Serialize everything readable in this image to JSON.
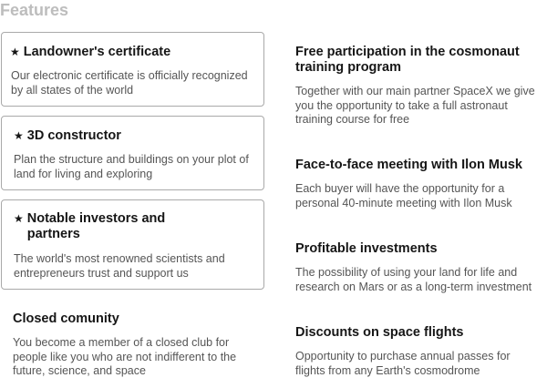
{
  "section": {
    "title": "Features"
  },
  "left": [
    {
      "title": "Landowner's certificate",
      "description": "Our electronic certificate is officially recognized by all states of the world",
      "icon": "star-icon"
    },
    {
      "title": "3D constructor",
      "description": "Plan the structure and buildings on your plot of land for living and exploring",
      "icon": "star-icon"
    },
    {
      "title": "Notable investors and partners",
      "description": "The world's most renowned scientists and entrepreneurs trust and support us",
      "icon": "star-icon"
    },
    {
      "title": "Closed comunity",
      "description": "You become a member of a closed club for people like you who are not indifferent to the future, science, and space"
    }
  ],
  "right": [
    {
      "title": "Free participation in the cosmonaut training program",
      "description": "Together with our main partner SpaceX we give you the opportunity to take a full astronaut training course for free"
    },
    {
      "title": "Face-to-face meeting with Ilon Musk",
      "description": "Each buyer will have the opportunity for a personal 40-minute meeting with Ilon Musk"
    },
    {
      "title": "Profitable investments",
      "description": "The possibility of using your land for life and research on Mars or as a long-term investment"
    },
    {
      "title": "Discounts on space flights",
      "description": "Opportunity to purchase annual passes for flights from any Earth's cosmodrome"
    }
  ]
}
